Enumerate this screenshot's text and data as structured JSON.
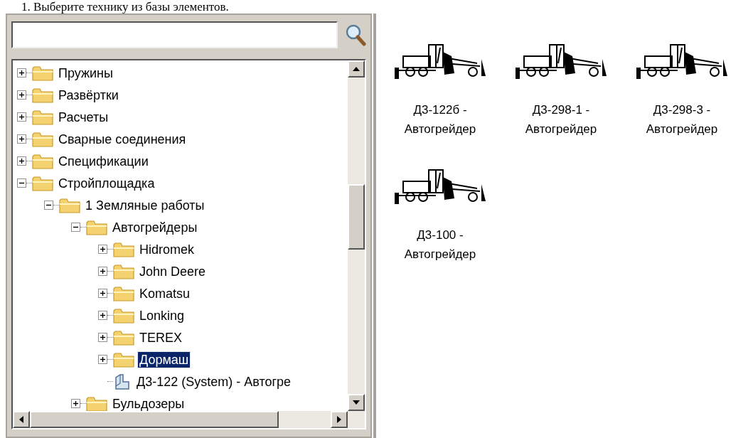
{
  "caption": "1.  Выберите технику из базы элементов.",
  "tree": [
    {
      "label": "Пружины",
      "kind": "folder",
      "expanded": false,
      "selected": false
    },
    {
      "label": "Развёртки",
      "kind": "folder",
      "expanded": false,
      "selected": false
    },
    {
      "label": "Расчеты",
      "kind": "folder",
      "expanded": false,
      "selected": false
    },
    {
      "label": "Сварные соединения",
      "kind": "folder",
      "expanded": false,
      "selected": false
    },
    {
      "label": "Спецификации",
      "kind": "folder",
      "expanded": false,
      "selected": false
    },
    {
      "label": "Стройплощадка",
      "kind": "folder",
      "expanded": true,
      "selected": false,
      "children": [
        {
          "label": "1 Земляные работы",
          "kind": "folder",
          "expanded": true,
          "selected": false,
          "children": [
            {
              "label": "Автогрейдеры",
              "kind": "folder",
              "expanded": true,
              "selected": false,
              "children": [
                {
                  "label": "Hidromek",
                  "kind": "folder",
                  "expanded": false,
                  "selected": false
                },
                {
                  "label": "John Deere",
                  "kind": "folder",
                  "expanded": false,
                  "selected": false
                },
                {
                  "label": "Komatsu",
                  "kind": "folder",
                  "expanded": false,
                  "selected": false
                },
                {
                  "label": "Lonking",
                  "kind": "folder",
                  "expanded": false,
                  "selected": false
                },
                {
                  "label": "TEREX",
                  "kind": "folder",
                  "expanded": false,
                  "selected": false
                },
                {
                  "label": "Дормаш",
                  "kind": "folder",
                  "expanded": false,
                  "selected": true
                },
                {
                  "label": "Д3-122 (System) - Автогре",
                  "kind": "item",
                  "selected": false
                }
              ]
            },
            {
              "label": "Бульдозеры",
              "kind": "folder",
              "expanded": false,
              "selected": false
            }
          ]
        }
      ]
    }
  ],
  "elements": [
    {
      "label": "Д3-122б - Автогрейдер"
    },
    {
      "label": "Д3-298-1 - Автогрейдер"
    },
    {
      "label": "Д3-298-3 - Автогрейдер"
    },
    {
      "label": "Д3-100 - Автогрейдер"
    }
  ]
}
